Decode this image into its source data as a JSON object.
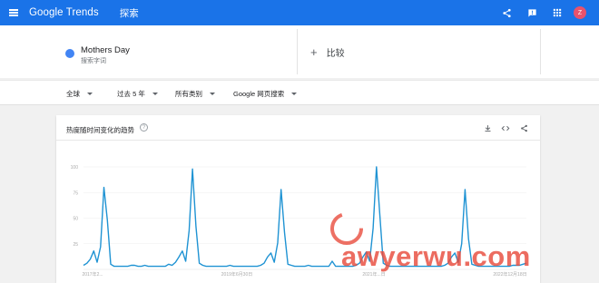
{
  "appbar": {
    "logo_google": "Google",
    "logo_trends": "Trends",
    "title": "探索",
    "bg_color": "#1a73e8",
    "icons": [
      "menu-icon",
      "share-icon",
      "feedback-icon",
      "apps-icon"
    ],
    "avatar_letter": "Z",
    "avatar_color": "#e8526c"
  },
  "compare": {
    "term": {
      "name": "Mothers Day",
      "type": "搜索字词",
      "color": "#4285f4"
    },
    "add_label": "比较"
  },
  "filters": [
    {
      "label": "全球"
    },
    {
      "label": "过去 5 年"
    },
    {
      "label": "所有类别"
    },
    {
      "label": "Google 网页搜索"
    }
  ],
  "card": {
    "title": "热度随时间变化的趋势",
    "help": "?",
    "actions": [
      "download-icon",
      "embed-icon",
      "share-icon"
    ]
  },
  "chart_data": {
    "type": "line",
    "series": [
      {
        "color": "#1f93d3",
        "values": [
          4,
          6,
          10,
          18,
          7,
          22,
          80,
          48,
          5,
          3,
          3,
          3,
          3,
          3,
          4,
          4,
          3,
          3,
          4,
          3,
          3,
          3,
          3,
          3,
          3,
          5,
          4,
          7,
          12,
          18,
          8,
          38,
          98,
          42,
          6,
          4,
          3,
          3,
          3,
          3,
          3,
          3,
          3,
          4,
          3,
          3,
          3,
          3,
          3,
          3,
          3,
          3,
          4,
          6,
          12,
          16,
          7,
          26,
          78,
          36,
          5,
          4,
          3,
          3,
          3,
          3,
          4,
          3,
          3,
          3,
          3,
          3,
          3,
          8,
          3,
          3,
          3,
          3,
          3,
          3,
          4,
          6,
          12,
          17,
          8,
          40,
          100,
          52,
          6,
          4,
          3,
          3,
          3,
          3,
          3,
          3,
          3,
          3,
          3,
          3,
          3,
          3,
          3,
          3,
          3,
          3,
          4,
          6,
          12,
          16,
          7,
          25,
          78,
          30,
          5,
          4,
          3,
          3,
          3,
          3,
          3,
          3,
          3,
          3,
          3,
          3,
          4,
          4,
          4,
          5,
          6
        ]
      }
    ],
    "y_ticks": [
      "100",
      "75",
      "50",
      "25"
    ],
    "x_ticks": [
      "2017年2...",
      "2019年6月30日",
      "2021年...日",
      "2022年12月18日"
    ],
    "ylim": [
      0,
      100
    ],
    "grid": true
  },
  "watermark": {
    "text": "awyerwu.com",
    "color": "#e84c3d"
  }
}
